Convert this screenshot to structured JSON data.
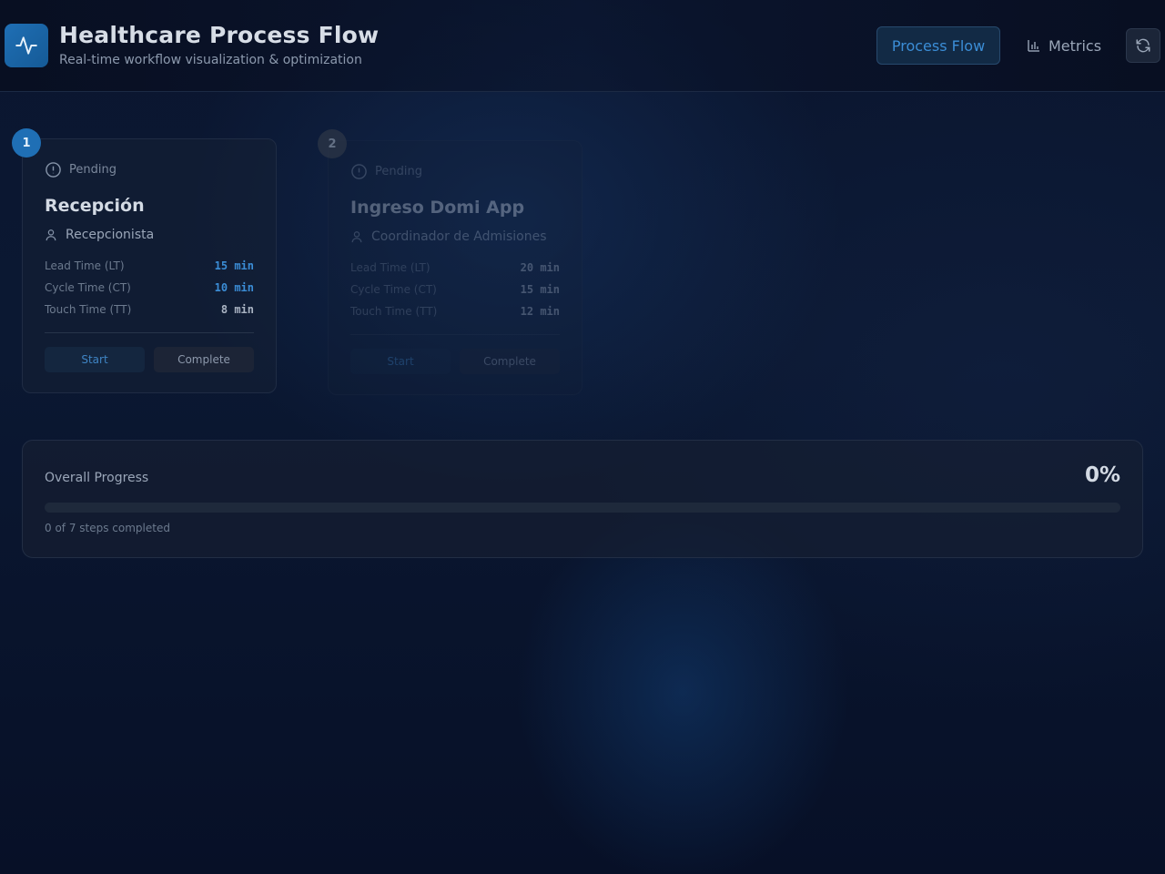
{
  "header": {
    "title": "Healthcare Process Flow",
    "subtitle": "Real-time workflow visualization & optimization",
    "nav": {
      "process_flow": "Process Flow",
      "metrics": "Metrics"
    }
  },
  "steps": [
    {
      "number": "1",
      "status": "Pending",
      "title": "Recepción",
      "role": "Recepcionista",
      "metrics": [
        {
          "label": "Lead Time (LT)",
          "value": "15 min"
        },
        {
          "label": "Cycle Time (CT)",
          "value": "10 min"
        },
        {
          "label": "Touch Time (TT)",
          "value": "8 min"
        }
      ],
      "start_label": "Start",
      "complete_label": "Complete"
    },
    {
      "number": "2",
      "status": "Pending",
      "title": "Ingreso Domi App",
      "role": "Coordinador de Admisiones",
      "metrics": [
        {
          "label": "Lead Time (LT)",
          "value": "20 min"
        },
        {
          "label": "Cycle Time (CT)",
          "value": "15 min"
        },
        {
          "label": "Touch Time (TT)",
          "value": "12 min"
        }
      ],
      "start_label": "Start",
      "complete_label": "Complete"
    }
  ],
  "progress": {
    "label": "Overall Progress",
    "percent_text": "0%",
    "fraction": 0,
    "caption": "0 of 7 steps completed"
  },
  "colors": {
    "accent": "#2f80c8",
    "accent_text": "#3b8dd6"
  },
  "icons": {
    "logo": "activity-pulse-icon",
    "metrics": "bar-chart-icon",
    "refresh": "refresh-icon",
    "status": "clock-alert-icon",
    "role": "user-icon"
  }
}
